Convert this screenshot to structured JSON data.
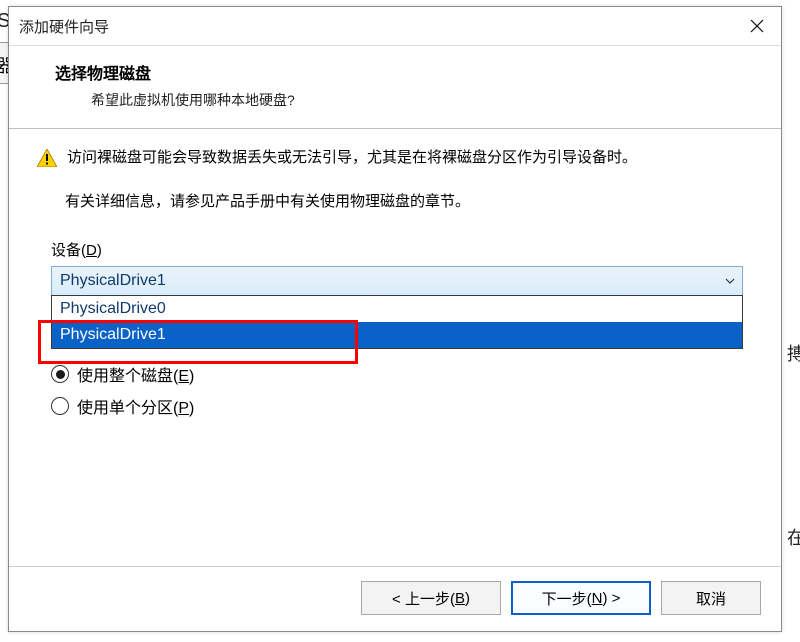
{
  "bg": {
    "left_char": "S",
    "left_char2": "器",
    "right_char1": "搏",
    "right_char2": "在"
  },
  "title": "添加硬件向导",
  "header": {
    "heading": "选择物理磁盘",
    "subheading": "希望此虚拟机使用哪种本地硬盘?"
  },
  "warning_text": "访问裸磁盘可能会导致数据丢失或无法引导，尤其是在将裸磁盘分区作为引导设备时。",
  "info_text": "有关详细信息，请参见产品手册中有关使用物理磁盘的章节。",
  "device": {
    "label_prefix": "设备(",
    "label_key": "D",
    "label_suffix": ")",
    "selected": "PhysicalDrive1",
    "options": [
      "PhysicalDrive0",
      "PhysicalDrive1"
    ]
  },
  "usage": {
    "opt1_prefix": "使用整个磁盘(",
    "opt1_key": "E",
    "opt1_suffix": ")",
    "opt2_prefix": "使用单个分区(",
    "opt2_key": "P",
    "opt2_suffix": ")",
    "selected_index": 0
  },
  "buttons": {
    "back_prefix": "< 上一步(",
    "back_key": "B",
    "back_suffix": ")",
    "next_prefix": "下一步(",
    "next_key": "N",
    "next_suffix": ") >",
    "cancel": "取消"
  }
}
